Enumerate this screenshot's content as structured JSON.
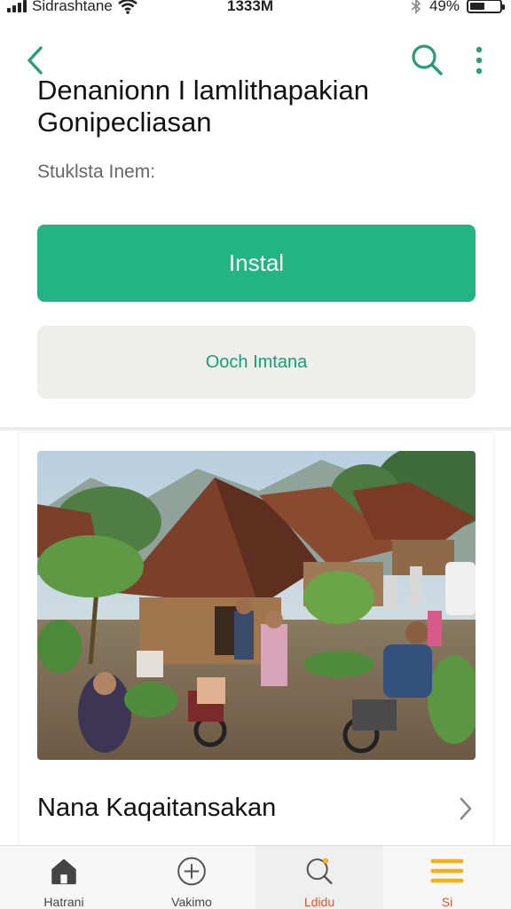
{
  "status_bar": {
    "carrier": "Sidrashtane",
    "time": "1333M",
    "battery": "49%",
    "battery_level": 0.49
  },
  "header": {
    "back_icon": "chevron-left-icon",
    "search_icon": "search-icon",
    "more_icon": "more-vertical-icon",
    "accent_color": "#2a9d76"
  },
  "app": {
    "title_line1": "Denanionn I lamlithapakian",
    "title_line2": "Gonipecliasan",
    "subtitle": "Stuklsta Inem:",
    "install_label": "Instal",
    "secondary_label": "Ooch Imtana",
    "install_color": "#22b583"
  },
  "card": {
    "title": "Nana Kaqaitansakan",
    "chevron_icon": "chevron-right-icon",
    "image_description_icon": "village-photo"
  },
  "bottom_nav": [
    {
      "label": "Hatrani",
      "icon": "home-icon"
    },
    {
      "label": "Vakimo",
      "icon": "add-circle-icon"
    },
    {
      "label": "Ldidu",
      "icon": "search-icon"
    },
    {
      "label": "Si",
      "icon": "menu-icon"
    }
  ]
}
